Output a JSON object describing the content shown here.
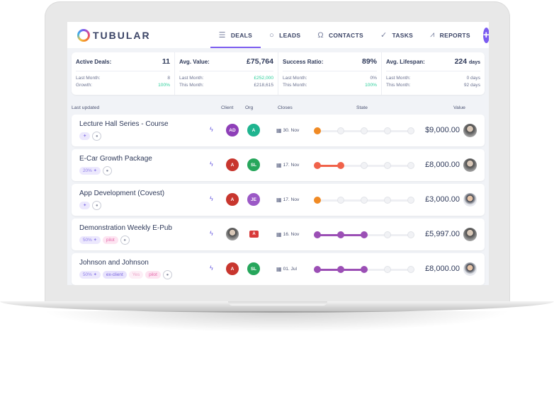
{
  "app": {
    "logo_text": "TUBULAR",
    "nav": [
      {
        "label": "DEALS",
        "icon": "sliders-icon",
        "glyph": "☰",
        "active": true
      },
      {
        "label": "LEADS",
        "icon": "circle-icon",
        "glyph": "○",
        "active": false
      },
      {
        "label": "CONTACTS",
        "icon": "person-icon",
        "glyph": "Ω",
        "active": false
      },
      {
        "label": "TASKS",
        "icon": "check-icon",
        "glyph": "✓",
        "active": false
      },
      {
        "label": "REPORTS",
        "icon": "chart-icon",
        "glyph": "⩘",
        "active": false
      }
    ],
    "add_label": "+",
    "accent": "#7b5cf0"
  },
  "stats": [
    {
      "title": "Active Deals:",
      "value": "11",
      "unit": "",
      "rows": [
        {
          "label": "Last Month:",
          "value": "8",
          "highlight": false
        },
        {
          "label": "Growth:",
          "value": "100%",
          "highlight": true
        }
      ]
    },
    {
      "title": "Avg. Value:",
      "value": "£75,764",
      "unit": "",
      "rows": [
        {
          "label": "Last Month:",
          "value": "£252,000",
          "highlight": true
        },
        {
          "label": "This Month:",
          "value": "£218,615",
          "highlight": false
        }
      ]
    },
    {
      "title": "Success Ratio:",
      "value": "89%",
      "unit": "",
      "rows": [
        {
          "label": "Last Month:",
          "value": "0%",
          "highlight": false
        },
        {
          "label": "This Month:",
          "value": "100%",
          "highlight": true
        }
      ]
    },
    {
      "title": "Avg. Lifespan:",
      "value": "224",
      "unit": "days",
      "rows": [
        {
          "label": "Last Month:",
          "value": "0 days",
          "highlight": false
        },
        {
          "label": "This Month:",
          "value": "92 days",
          "highlight": false
        }
      ]
    }
  ],
  "table": {
    "headers": {
      "last_updated": "Last updated",
      "client": "Client",
      "org": "Org",
      "closes": "Closes",
      "state": "State",
      "value": "Value"
    },
    "deals": [
      {
        "title": "Lecture Hall Series - Course",
        "tags": [
          {
            "text": "✦",
            "style": ""
          }
        ],
        "client": {
          "type": "initials",
          "text": "AD",
          "color": "#8e3fb8"
        },
        "org": {
          "type": "initials",
          "text": "A",
          "color": "#1fb48f"
        },
        "closes": "30. Nov",
        "state": {
          "step": 1,
          "total": 5,
          "color": "#f08a24"
        },
        "value": "$9,000.00",
        "owner": "photo"
      },
      {
        "title": "E-Car Growth Package",
        "tags": [
          {
            "text": "20% ✦",
            "style": ""
          }
        ],
        "client": {
          "type": "initials",
          "text": "A",
          "color": "#c8362e"
        },
        "org": {
          "type": "initials",
          "text": "SL",
          "color": "#26a65b"
        },
        "closes": "17. Nov",
        "state": {
          "step": 2,
          "total": 5,
          "color": "#f0624a"
        },
        "value": "£8,000.00",
        "owner": "photo"
      },
      {
        "title": "App Development (Covest)",
        "tags": [
          {
            "text": "✦",
            "style": ""
          }
        ],
        "client": {
          "type": "initials",
          "text": "A",
          "color": "#c8362e"
        },
        "org": {
          "type": "initials",
          "text": "JE",
          "color": "#9b59c6"
        },
        "closes": "17. Nov",
        "state": {
          "step": 1,
          "total": 5,
          "color": "#f08a24"
        },
        "value": "£3,000.00",
        "owner": "photo2"
      },
      {
        "title": "Demonstration Weekly E-Pub",
        "tags": [
          {
            "text": "50% ✦",
            "style": ""
          },
          {
            "text": "pilot",
            "style": "pink"
          }
        ],
        "client": {
          "type": "photo",
          "text": "",
          "color": ""
        },
        "org": {
          "type": "flag",
          "text": "A",
          "color": "#d83a3a"
        },
        "closes": "16. Nov",
        "state": {
          "step": 3,
          "total": 5,
          "color": "#9b4fb5"
        },
        "value": "£5,997.00",
        "owner": "photo"
      },
      {
        "title": "Johnson and Johnson",
        "tags": [
          {
            "text": "50% ✦",
            "style": ""
          },
          {
            "text": "ex-client",
            "style": "purple"
          },
          {
            "text": "Yes",
            "style": "pink-light"
          },
          {
            "text": "pilot",
            "style": "pink"
          }
        ],
        "client": {
          "type": "initials",
          "text": "A",
          "color": "#c8362e"
        },
        "org": {
          "type": "initials",
          "text": "SL",
          "color": "#26a65b"
        },
        "closes": "01. Jul",
        "state": {
          "step": 3,
          "total": 5,
          "color": "#9b4fb5"
        },
        "value": "£8,000.00",
        "owner": "photo2"
      }
    ]
  }
}
